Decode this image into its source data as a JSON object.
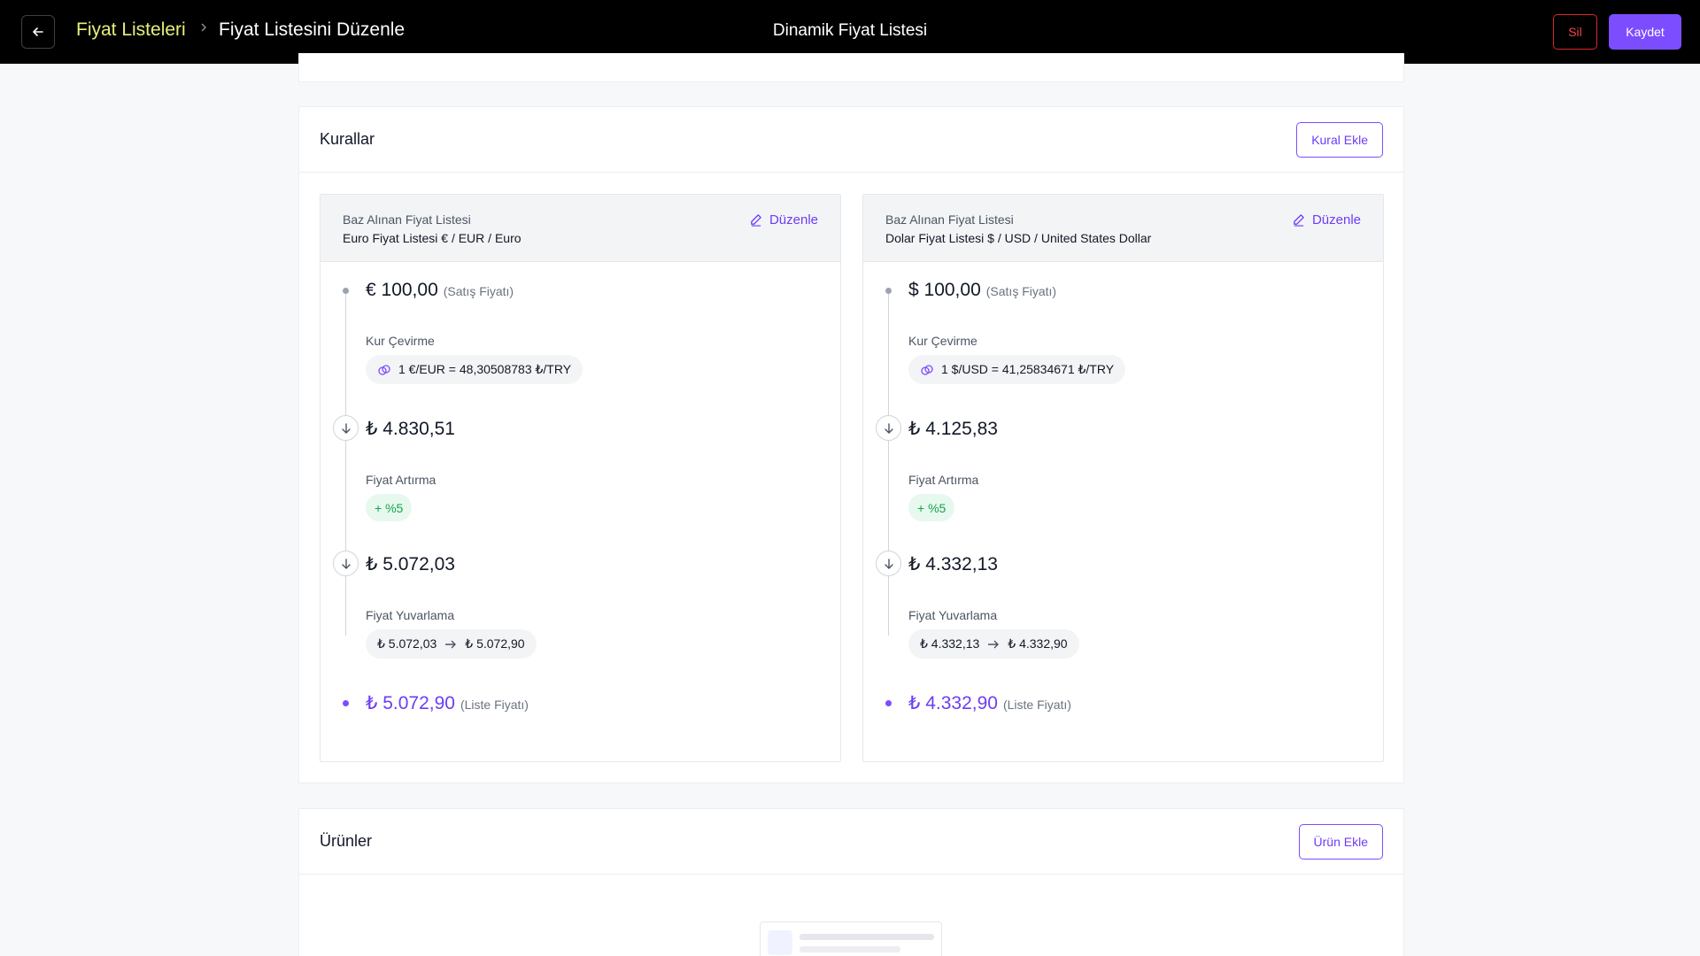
{
  "header": {
    "breadcrumb_parent": "Fiyat Listeleri",
    "breadcrumb_current": "Fiyat Listesini Düzenle",
    "title": "Dinamik Fiyat Listesi",
    "delete_label": "Sil",
    "save_label": "Kaydet"
  },
  "rules": {
    "title": "Kurallar",
    "add_label": "Kural Ekle",
    "cards": [
      {
        "base_label": "Baz Alınan Fiyat Listesi",
        "base_value": "Euro Fiyat Listesi € / EUR / Euro",
        "edit_label": "Düzenle",
        "sale_price": "€ 100,00",
        "sale_note": "(Satış Fiyatı)",
        "conversion_label": "Kur Çevirme",
        "conversion_rate": "1 €/EUR = 48,30508783 ₺/TRY",
        "converted_price": "₺ 4.830,51",
        "increase_label": "Fiyat Artırma",
        "increase_value": "+ %5",
        "increased_price": "₺ 5.072,03",
        "rounding_label": "Fiyat Yuvarlama",
        "rounding_from": "₺ 5.072,03",
        "rounding_to": "₺ 5.072,90",
        "list_price": "₺ 5.072,90",
        "list_note": "(Liste Fiyatı)"
      },
      {
        "base_label": "Baz Alınan Fiyat Listesi",
        "base_value": "Dolar Fiyat Listesi $ / USD / United States Dollar",
        "edit_label": "Düzenle",
        "sale_price": "$ 100,00",
        "sale_note": "(Satış Fiyatı)",
        "conversion_label": "Kur Çevirme",
        "conversion_rate": "1 $/USD = 41,25834671 ₺/TRY",
        "converted_price": "₺ 4.125,83",
        "increase_label": "Fiyat Artırma",
        "increase_value": "+ %5",
        "increased_price": "₺ 4.332,13",
        "rounding_label": "Fiyat Yuvarlama",
        "rounding_from": "₺ 4.332,13",
        "rounding_to": "₺ 4.332,90",
        "list_price": "₺ 4.332,90",
        "list_note": "(Liste Fiyatı)"
      }
    ]
  },
  "products": {
    "title": "Ürünler",
    "add_label": "Ürün Ekle"
  },
  "colors": {
    "accent": "#7c4dff",
    "breadcrumb": "#e7f07a",
    "danger": "#ef4444",
    "success": "#16a34a"
  }
}
